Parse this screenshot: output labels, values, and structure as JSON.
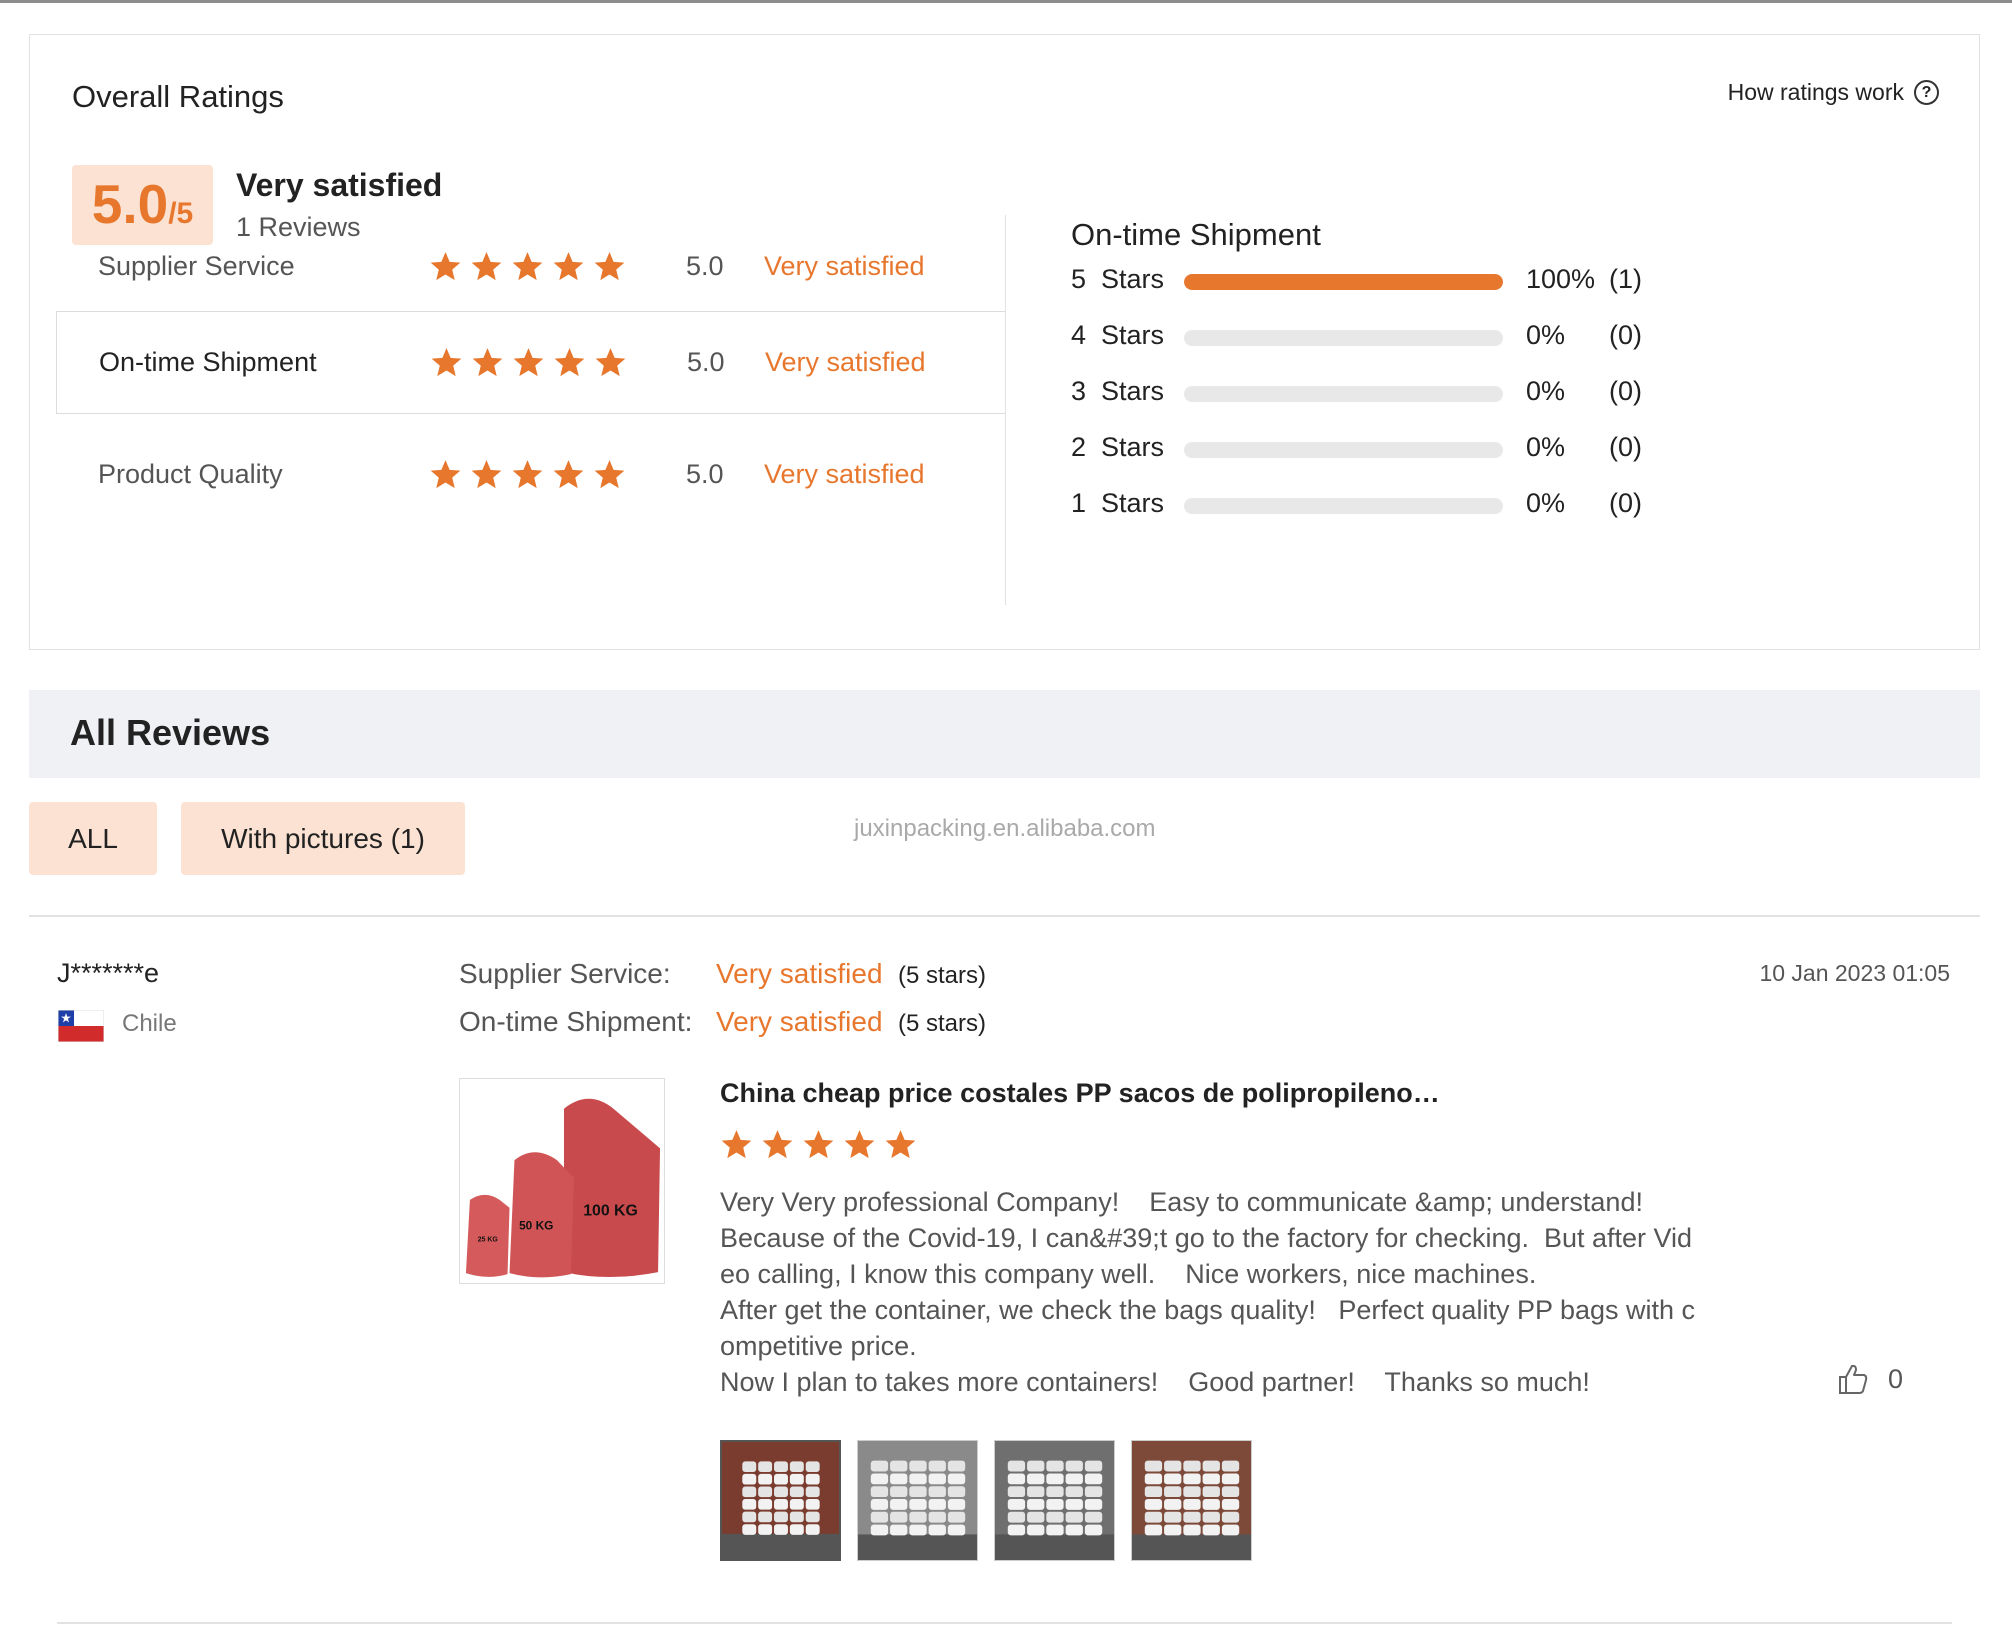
{
  "ratings": {
    "title": "Overall Ratings",
    "how_link": "How ratings work",
    "help_glyph": "?",
    "score": "5.0",
    "score_denominator": "/5",
    "summary_label": "Very satisfied",
    "review_count": "1 Reviews",
    "dimensions": [
      {
        "label": "Supplier Service",
        "stars": 5,
        "score": "5.0",
        "text": "Very satisfied"
      },
      {
        "label": "On-time Shipment",
        "stars": 5,
        "score": "5.0",
        "text": "Very satisfied"
      },
      {
        "label": "Product Quality",
        "stars": 5,
        "score": "5.0",
        "text": "Very satisfied"
      }
    ],
    "distribution_title": "On-time Shipment",
    "distribution": [
      {
        "label": "5  Stars",
        "fraction": 1.0,
        "percent": "100%",
        "count": "(1)"
      },
      {
        "label": "4  Stars",
        "fraction": 0.0,
        "percent": "0%",
        "count": "(0)"
      },
      {
        "label": "3  Stars",
        "fraction": 0.0,
        "percent": "0%",
        "count": "(0)"
      },
      {
        "label": "2  Stars",
        "fraction": 0.0,
        "percent": "0%",
        "count": "(0)"
      },
      {
        "label": "1  Stars",
        "fraction": 0.0,
        "percent": "0%",
        "count": "(0)"
      }
    ]
  },
  "reviews": {
    "title": "All Reviews",
    "filters": [
      {
        "label": "ALL"
      },
      {
        "label": "With pictures (1)"
      }
    ],
    "watermark": "juxinpacking.en.alibaba.com"
  },
  "review": {
    "reviewer": "J*******e",
    "country": "Chile",
    "ratings": [
      {
        "label": "Supplier Service:",
        "value": "Very satisfied",
        "stars_text": "(5 stars)"
      },
      {
        "label": "On-time Shipment:",
        "value": "Very satisfied",
        "stars_text": "(5 stars)"
      }
    ],
    "date": "10 Jan 2023 01:05",
    "product_title": "China cheap price costales PP sacos de polipropileno…",
    "product_stars": 5,
    "product_image_labels": [
      "100 KG",
      "50 KG",
      "25 KG"
    ],
    "text_lines": [
      "Very Very professional Company!    Easy to communicate &amp; understand!",
      "Because of the Covid-19, I can&#39;t go to the factory for checking.  But after Vid",
      "eo calling, I know this company well.    Nice workers, nice machines.",
      "After get the container, we check the bags quality!   Perfect quality PP bags with c",
      "ompetitive price.",
      "Now I plan to takes more containers!    Good partner!    Thanks so much!"
    ],
    "likes": "0",
    "photo_count": 4
  },
  "colors": {
    "accent": "#e8772e",
    "accent_bg": "#fbe2d2",
    "header_bg": "#eff1f4",
    "bar_track": "#e8e8e8"
  },
  "icons": [
    "help-circle-icon",
    "star-icon",
    "chile-flag-icon",
    "thumbs-up-icon"
  ]
}
